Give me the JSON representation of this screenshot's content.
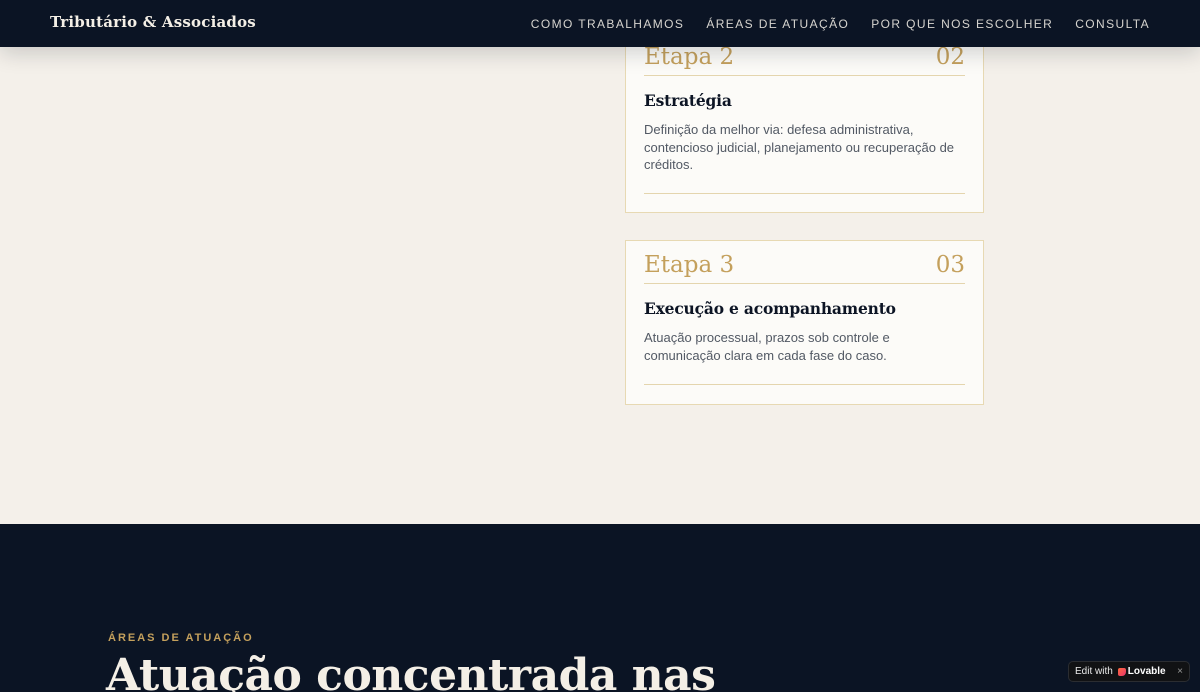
{
  "header": {
    "brand": "Tributário & Associados",
    "nav": [
      "COMO TRABALHAMOS",
      "ÁREAS DE ATUAÇÃO",
      "POR QUE NOS ESCOLHER",
      "CONSULTA"
    ]
  },
  "steps": [
    {
      "label": "Etapa 2",
      "number": "02",
      "title": "Estratégia",
      "description": "Definição da melhor via: defesa administrativa, contencioso judicial, planejamento ou recuperação de créditos."
    },
    {
      "label": "Etapa 3",
      "number": "03",
      "title": "Execução e acompanhamento",
      "description": "Atuação processual, prazos sob controle e comunicação clara em cada fase do caso."
    }
  ],
  "areas": {
    "eyebrow": "ÁREAS DE ATUAÇÃO",
    "title": "Atuação concentrada nas"
  },
  "badge": {
    "prefix": "Edit with",
    "logo": "Lovable",
    "close": "×",
    "heart_icon": "lovable-heart-icon"
  },
  "colors": {
    "navy": "#0b1424",
    "gold": "#c4a05c",
    "cream": "#f4f0ea",
    "card": "#fcfbf8"
  }
}
